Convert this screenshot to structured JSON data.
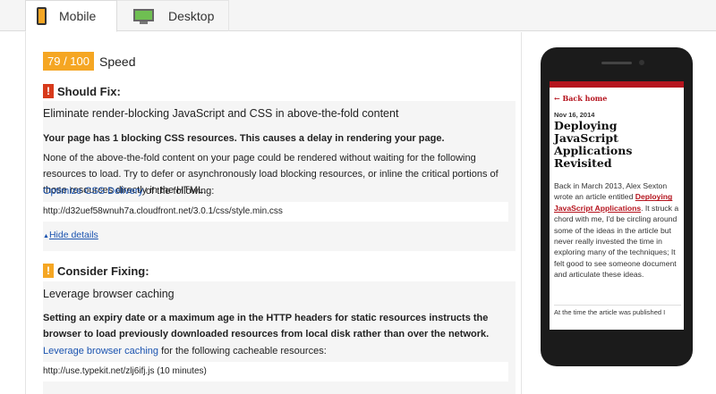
{
  "tabs": {
    "mobile_label": "Mobile",
    "desktop_label": "Desktop"
  },
  "score": {
    "value": "79 / 100",
    "label": "Speed",
    "color": "#f5a623"
  },
  "should_fix": {
    "heading": "Should Fix:",
    "rule_title": "Eliminate render-blocking JavaScript and CSS in above-the-fold content",
    "summary": "Your page has 1 blocking CSS resources. This causes a delay in rendering your page.",
    "explanation": "None of the above-the-fold content on your page could be rendered without waiting for the following resources to load. Try to defer or asynchronously load blocking resources, or inline the critical portions of those resources directly in the HTML.",
    "optimize_link": "Optimize CSS Delivery",
    "optimize_suffix": " of the following:",
    "resource_url": "http://d32uef58wnuh7a.cloudfront.net/3.0.1/css/style.min.css",
    "hide_details": "Hide details"
  },
  "consider_fixing": {
    "heading": "Consider Fixing:",
    "rule_title": "Leverage browser caching",
    "summary": "Setting an expiry date or a maximum age in the HTTP headers for static resources instructs the browser to load previously downloaded resources from local disk rather than over the network.",
    "caching_link": "Leverage browser caching",
    "caching_suffix": " for the following cacheable resources:",
    "resource_url": "http://use.typekit.net/zlj6ifj.js (10 minutes)"
  },
  "preview": {
    "back_home": "← Back home",
    "date": "Nov 16, 2014",
    "title": "Deploying JavaScript Applications Revisited",
    "body_before": "Back in March 2013, Alex Sexton wrote an article entitled ",
    "body_link": "Deploying JavaScript Applications",
    "body_after": ". It struck a chord with me, I'd be circling around some of the ideas in the article but never really invested the time in exploring many of the techniques; It felt good to see someone document and articulate these ideas.",
    "more": "At the time the article was published I",
    "accent_color": "#b5141e"
  }
}
